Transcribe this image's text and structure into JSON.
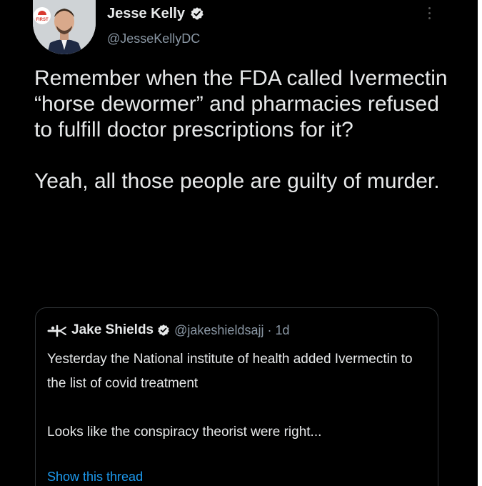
{
  "author": {
    "name": "Jesse Kelly",
    "handle": "@JesseKellyDC",
    "avatar_badge": "FIRST",
    "verified_icon": "verified-badge-icon"
  },
  "tweet": {
    "paragraphs": [
      "Remember when the FDA called Ivermectin “horse dewormer” and pharmacies refused to fulfill doctor prescriptions for it?",
      "Yeah, all those people are guilty of murder."
    ]
  },
  "quoted_tweet": {
    "name": "Jake Shields",
    "handle_meta": "@jakeshieldsajj · 1d",
    "paragraphs": [
      "Yesterday the National institute of health added Ivermectin to the list of covid treatment",
      "Looks like the conspiracy theorist were right..."
    ],
    "show_thread": "Show this thread"
  },
  "colors": {
    "background": "#000000",
    "text": "#e7e9ea",
    "secondary_text": "#8b98a5",
    "link": "#1d9bf0"
  }
}
